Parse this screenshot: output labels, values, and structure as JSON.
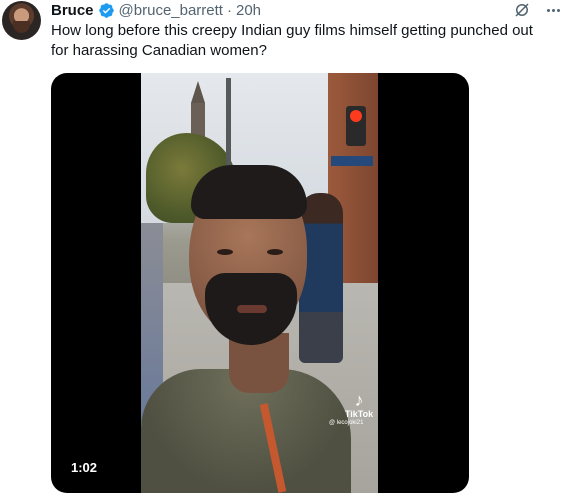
{
  "author": {
    "name": "Bruce",
    "handle": "@bruce_barrett",
    "separator": "·",
    "time": "20h"
  },
  "tweet": {
    "text": "How long before this creepy Indian guy films himself getting punched out for harassing Canadian women?"
  },
  "media": {
    "duration": "1:02",
    "watermark_brand": "TikTok",
    "watermark_user": "@ lecojoki21"
  },
  "icons": {
    "verified": "verified-badge-icon",
    "grok": "grok-icon",
    "more": "more-icon",
    "tiktok": "tiktok-logo-icon"
  },
  "colors": {
    "verified": "#1d9bf0",
    "text_primary": "#0f1419",
    "text_secondary": "#536471"
  }
}
